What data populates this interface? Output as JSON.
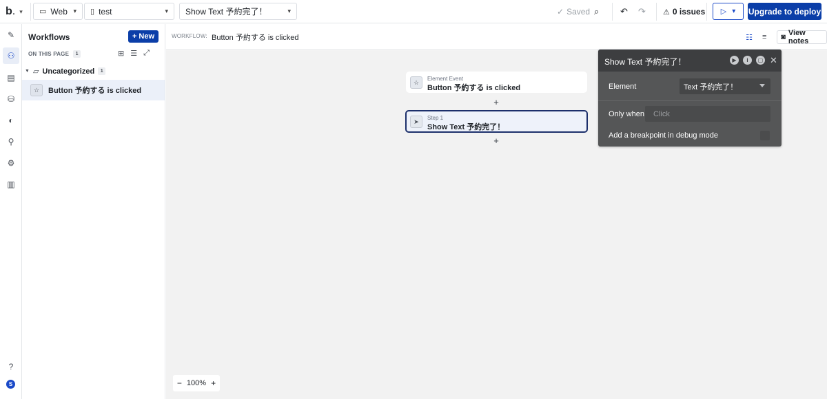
{
  "topbar": {
    "logo": "b",
    "platform": "Web",
    "page": "test",
    "workflow_select": "Show Text 予約完了！",
    "saved": "Saved",
    "issues": "0 issues",
    "deploy": "Upgrade to deploy"
  },
  "sidebar": {
    "title": "Workflows",
    "new_label": "New",
    "on_this_page": "ON THIS PAGE",
    "page_count": "1",
    "folder_label": "Uncategorized",
    "folder_count": "1",
    "item_label": "Button 予約する is clicked"
  },
  "canvas_header": {
    "label": "WORKFLOW:",
    "name": "Button 予約する is clicked",
    "view_notes": "View notes"
  },
  "canvas": {
    "event_sub": "Element Event",
    "event_main": "Button 予約する is clicked",
    "step_sub": "Step 1",
    "step_main": "Show Text 予約完了！",
    "zoom": "100%"
  },
  "panel": {
    "title": "Show Text 予約完了！",
    "element_label": "Element",
    "element_value": "Text 予約完了！",
    "only_when_label": "Only when",
    "only_when_placeholder": "Click",
    "breakpoint_label": "Add a breakpoint in debug mode"
  },
  "colors": {
    "accent": "#0b3ea8",
    "selected_step_border": "#1c2f6b",
    "panel_bg": "#555657"
  }
}
